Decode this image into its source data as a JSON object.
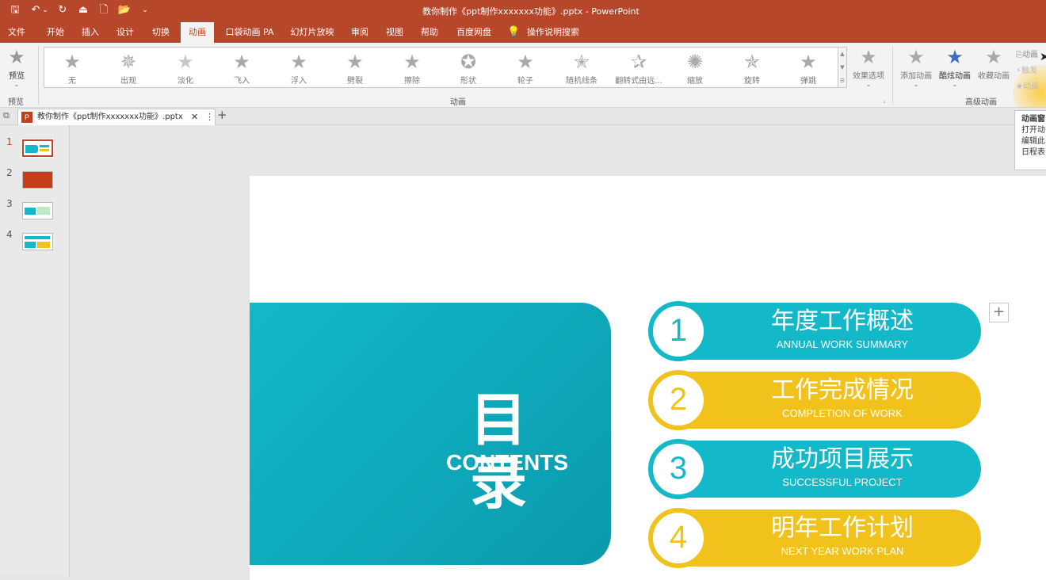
{
  "window": {
    "title": "教你制作《ppt制作xxxxxxx功能》.pptx  -  PowerPoint"
  },
  "qat": {
    "save": "🖫",
    "undo": "↶",
    "undo_dd": "⌄",
    "redo": "↻",
    "present": "⏏",
    "new": "🗋",
    "open": "📂",
    "more": "⌄"
  },
  "menu": [
    "文件",
    "开始",
    "插入",
    "设计",
    "切换",
    "动画",
    "口袋动画 PA",
    "幻灯片放映",
    "审阅",
    "视图",
    "帮助",
    "百度网盘",
    "操作说明搜索"
  ],
  "ribbon": {
    "preview_label": "预览",
    "preview_group": "预览",
    "animations": [
      "无",
      "出现",
      "淡化",
      "飞入",
      "浮入",
      "劈裂",
      "擦除",
      "形状",
      "轮子",
      "随机线条",
      "翻转式由远...",
      "缩放",
      "旋转",
      "弹跳"
    ],
    "effect_options": "效果选项",
    "animation_group": "动画",
    "add_animation": "添加动画",
    "cool_animation": "酷炫动画",
    "fav_animation": "收藏动画",
    "advanced_group": "高级动画",
    "anim_pane": "动画",
    "trigger": "触发",
    "anim_painter": "动画"
  },
  "doc_tab": {
    "name": "教你制作《ppt制作xxxxxxx功能》.pptx",
    "close": "✕",
    "menu": "⋮",
    "new": "+"
  },
  "thumbnails": [
    "1",
    "2",
    "3",
    "4"
  ],
  "slide": {
    "title_cn": "目 录",
    "title_en": "CONTENTS",
    "items": [
      {
        "num": "1",
        "cn": "年度工作概述",
        "en": "ANNUAL WORK SUMMARY"
      },
      {
        "num": "2",
        "cn": "工作完成情况",
        "en": "COMPLETION OF WORK"
      },
      {
        "num": "3",
        "cn": "成功项目展示",
        "en": "SUCCESSFUL PROJECT"
      },
      {
        "num": "4",
        "cn": "明年工作计划",
        "en": "NEXT YEAR WORK PLAN"
      }
    ]
  },
  "tooltip": {
    "title": "动画窗",
    "l1": "打开动",
    "l2": "编辑此",
    "l3": "日程表"
  },
  "colors": {
    "brand": "#b7472a",
    "teal": "#13b9c9",
    "yellow": "#f1c21b"
  }
}
